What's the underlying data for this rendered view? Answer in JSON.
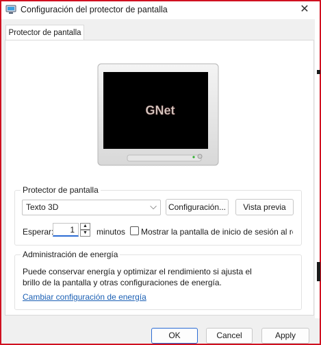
{
  "window": {
    "title": "Configuración del protector de pantalla",
    "close_glyph": "✕"
  },
  "tabs": [
    {
      "label": "Protector de pantalla",
      "active": true
    }
  ],
  "preview": {
    "screen_text": "GNet"
  },
  "screensaver": {
    "group_label": "Protector de pantalla",
    "selected": "Texto 3D",
    "settings_button": "Configuración...",
    "preview_button": "Vista previa",
    "wait_label": "Esperar:",
    "wait_value": "1",
    "minutes_label": "minutos",
    "show_logon_label": "Mostrar la pantalla de inicio de sesión al re",
    "show_logon_checked": false
  },
  "power": {
    "group_label": "Administración de energía",
    "description": "Puede conservar energía y optimizar el rendimiento si ajusta el brillo de la pantalla y otras configuraciones de energía.",
    "link": "Cambiar configuración de energía"
  },
  "footer": {
    "ok": "OK",
    "cancel": "Cancel",
    "apply": "Apply"
  },
  "colors": {
    "frame": "#d01020",
    "accent": "#2a6bd4",
    "link": "#1a5fb4"
  }
}
